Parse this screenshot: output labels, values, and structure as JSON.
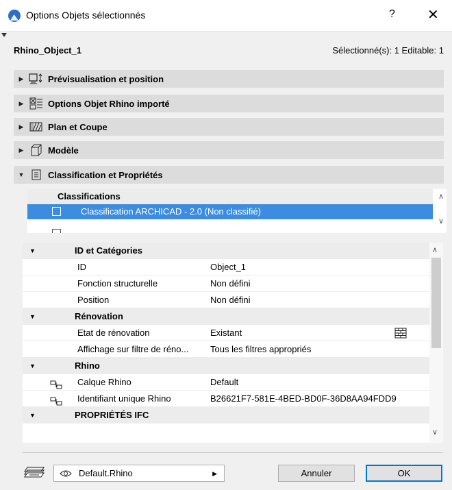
{
  "window": {
    "title": "Options Objets sélectionnés",
    "help_label": "?",
    "close_label": "✕"
  },
  "object": {
    "name": "Rhino_Object_1",
    "selection_info": "Sélectionné(s): 1 Editable: 1"
  },
  "panels": [
    {
      "label": "Prévisualisation et position",
      "icon": "preview-position-icon",
      "expanded": false
    },
    {
      "label": "Options Objet Rhino importé",
      "icon": "rhino-options-icon",
      "expanded": false
    },
    {
      "label": "Plan et Coupe",
      "icon": "plan-section-icon",
      "expanded": false
    },
    {
      "label": "Modèle",
      "icon": "model-cube-icon",
      "expanded": false
    },
    {
      "label": "Classification et Propriétés",
      "icon": "classification-document-icon",
      "expanded": true
    }
  ],
  "classifications": {
    "header": "Classifications",
    "selected_item": "Classification ARCHICAD - 2.0 (Non classifié)"
  },
  "properties": {
    "groups": [
      {
        "name": "ID et Catégories",
        "rows": [
          {
            "key": "ID",
            "value": "Object_1"
          },
          {
            "key": "Fonction structurelle",
            "value": "Non défini"
          },
          {
            "key": "Position",
            "value": "Non défini"
          }
        ]
      },
      {
        "name": "Rénovation",
        "rows": [
          {
            "key": "Etat de rénovation",
            "value": "Existant",
            "icon": "renovation-brick-icon"
          },
          {
            "key": "Affichage sur filtre de réno...",
            "value": "Tous les filtres appropriés"
          }
        ]
      },
      {
        "name": "Rhino",
        "rows": [
          {
            "key": "Calque Rhino",
            "value": "Default",
            "icon": "link-icon"
          },
          {
            "key": "Identifiant unique Rhino",
            "value": "B26621F7-581E-4BED-BD0F-36D8AA94FDD9",
            "icon": "link-icon"
          }
        ]
      },
      {
        "name": "PROPRIÉTÉS IFC",
        "rows": []
      }
    ]
  },
  "footer": {
    "favorite_name": "Default.Rhino",
    "cancel_label": "Annuler",
    "ok_label": "OK"
  },
  "colors": {
    "selection_blue": "#3c8ce0",
    "group_header": "#ececec",
    "panel_header": "#dcdcdc",
    "ok_border": "#0078d7"
  }
}
